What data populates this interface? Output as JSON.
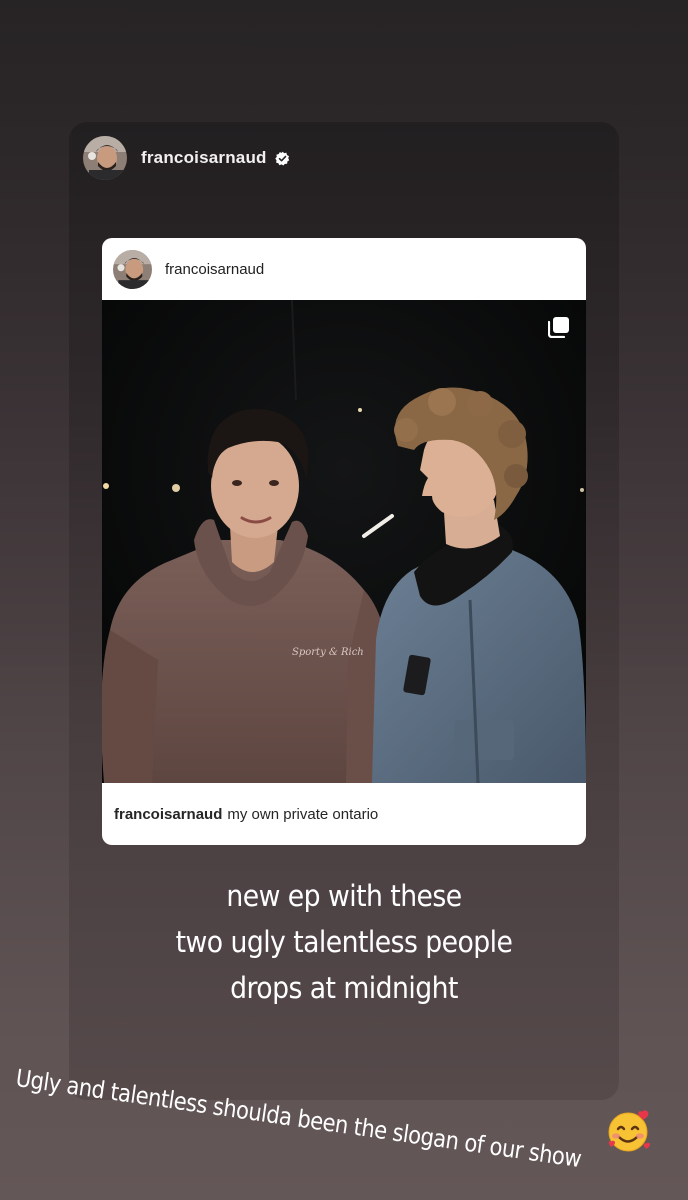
{
  "story": {
    "username": "francoisarnaud",
    "verified_icon": "verified-badge-icon",
    "avatar": "profile-avatar"
  },
  "shared_post": {
    "username": "francoisarnaud",
    "multi_photo_icon": "carousel-icon",
    "caption_username": "francoisarnaud",
    "caption_text": "my own private ontario"
  },
  "story_text": {
    "line1": "new ep with these",
    "line2": "two ugly talentless people",
    "line3": "drops at midnight"
  },
  "overlay": {
    "comment": "Ugly and talentless shoulda been the slogan of our show",
    "emoji": "smiling-face-with-hearts-icon"
  },
  "colors": {
    "background_top": "#272426",
    "background_bottom": "#645757",
    "text": "#ffffff",
    "verified": "#ffffff"
  }
}
